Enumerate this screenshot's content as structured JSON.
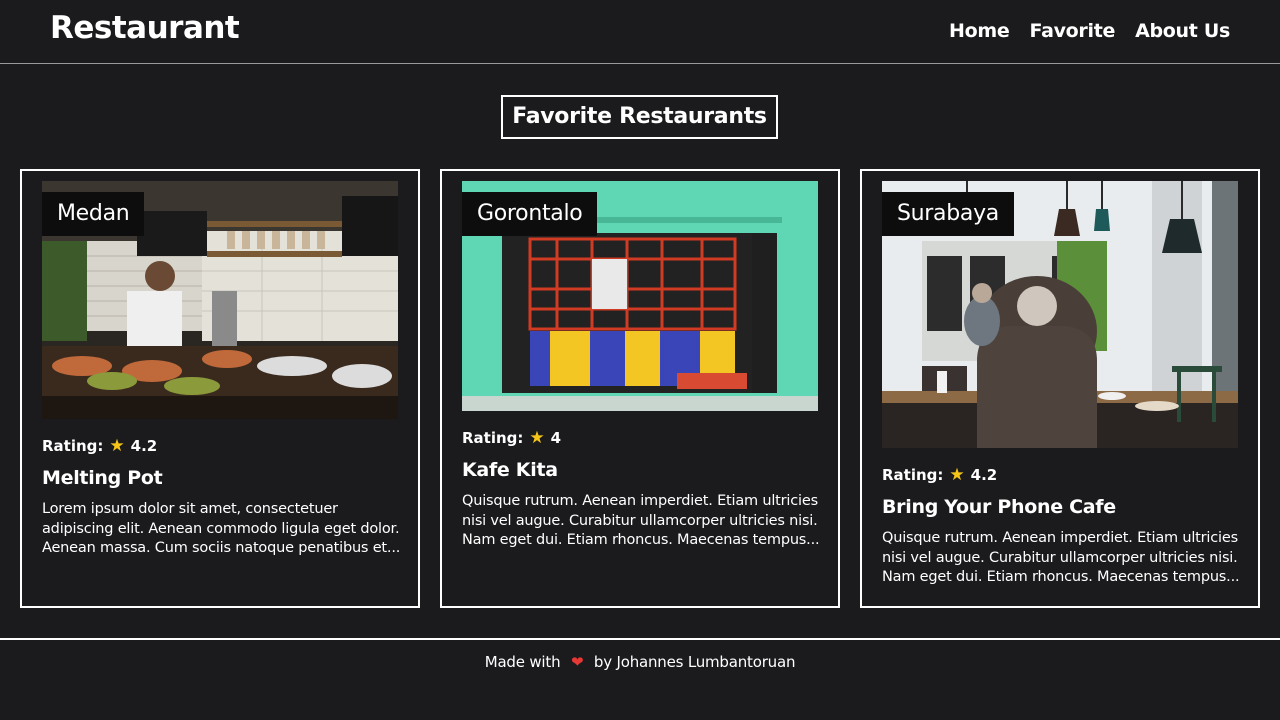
{
  "header": {
    "brand": "Restaurant",
    "nav": [
      {
        "label": "Home"
      },
      {
        "label": "Favorite"
      },
      {
        "label": "About Us"
      }
    ]
  },
  "main": {
    "title": "Favorite Restaurants",
    "rating_label": "Rating:",
    "cards": [
      {
        "city": "Medan",
        "rating": "4.2",
        "name": "Melting Pot",
        "description": "Lorem ipsum dolor sit amet, consectetuer adipiscing elit. Aenean commodo ligula eget dolor. Aenean massa. Cum sociis natoque penatibus et..."
      },
      {
        "city": "Gorontalo",
        "rating": "4",
        "name": "Kafe Kita",
        "description": "Quisque rutrum. Aenean imperdiet. Etiam ultricies nisi vel augue. Curabitur ullamcorper ultricies nisi. Nam eget dui. Etiam rhoncus. Maecenas tempus..."
      },
      {
        "city": "Surabaya",
        "rating": "4.2",
        "name": "Bring Your Phone Cafe",
        "description": "Quisque rutrum. Aenean imperdiet. Etiam ultricies nisi vel augue. Curabitur ullamcorper ultricies nisi. Nam eget dui. Etiam rhoncus. Maecenas tempus..."
      }
    ]
  },
  "footer": {
    "prefix": "Made with",
    "suffix": "by Johannes Lumbantoruan"
  },
  "icons": {
    "star": "star-icon",
    "heart": "heart-icon"
  },
  "colors": {
    "background": "#1b1b1e",
    "star": "#f5c518",
    "heart": "#e53935"
  }
}
